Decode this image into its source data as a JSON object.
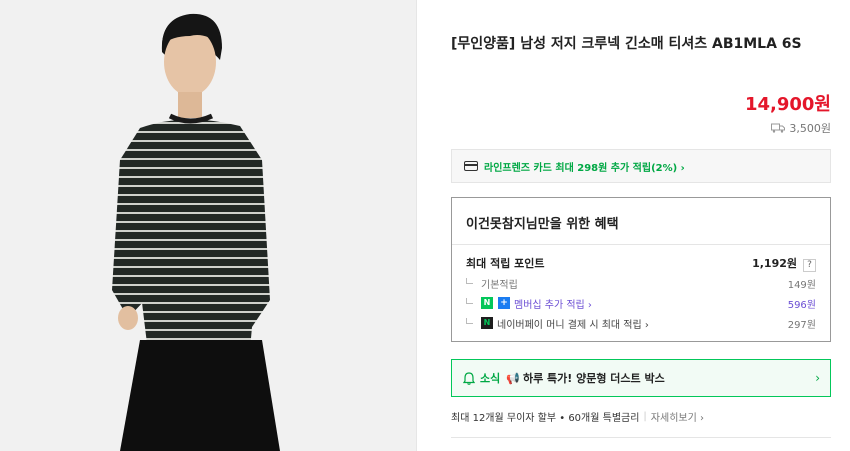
{
  "product": {
    "title": "[무인양품] 남성 저지 크루넥 긴소매 티셔츠 AB1MLA 6S",
    "price": "14,900원",
    "shipping": "3,500원",
    "image_alt": "product-photo"
  },
  "card_promo": {
    "text": "라인프렌즈 카드 최대 298원 추가 적립(2%) ›"
  },
  "benefit": {
    "title": "이건못참지님만을 위한 혜택",
    "max_points_label": "최대 적립 포인트",
    "max_points_value": "1,192원",
    "help": "?",
    "rows": [
      {
        "label": "기본적립",
        "value": "149원"
      },
      {
        "label": "멤버십 추가 적립 ›",
        "value": "596원",
        "badge_n": "N",
        "badge_plus": "+"
      },
      {
        "label": "네이버페이 머니 결제 시 최대 적립 ›",
        "value": "297원",
        "badge_n": "N"
      }
    ]
  },
  "news": {
    "label": "소식",
    "text": "하루 특가! 양문형 더스트 박스",
    "chevron": "›"
  },
  "installment": {
    "text": "최대 12개월 무이자 할부 • 60개월 특별금리",
    "sep": "|",
    "more": "자세히보기 ›"
  },
  "colors": {
    "price": "#e4162a",
    "accent_green": "#00a844",
    "purple": "#6c4fd4"
  }
}
